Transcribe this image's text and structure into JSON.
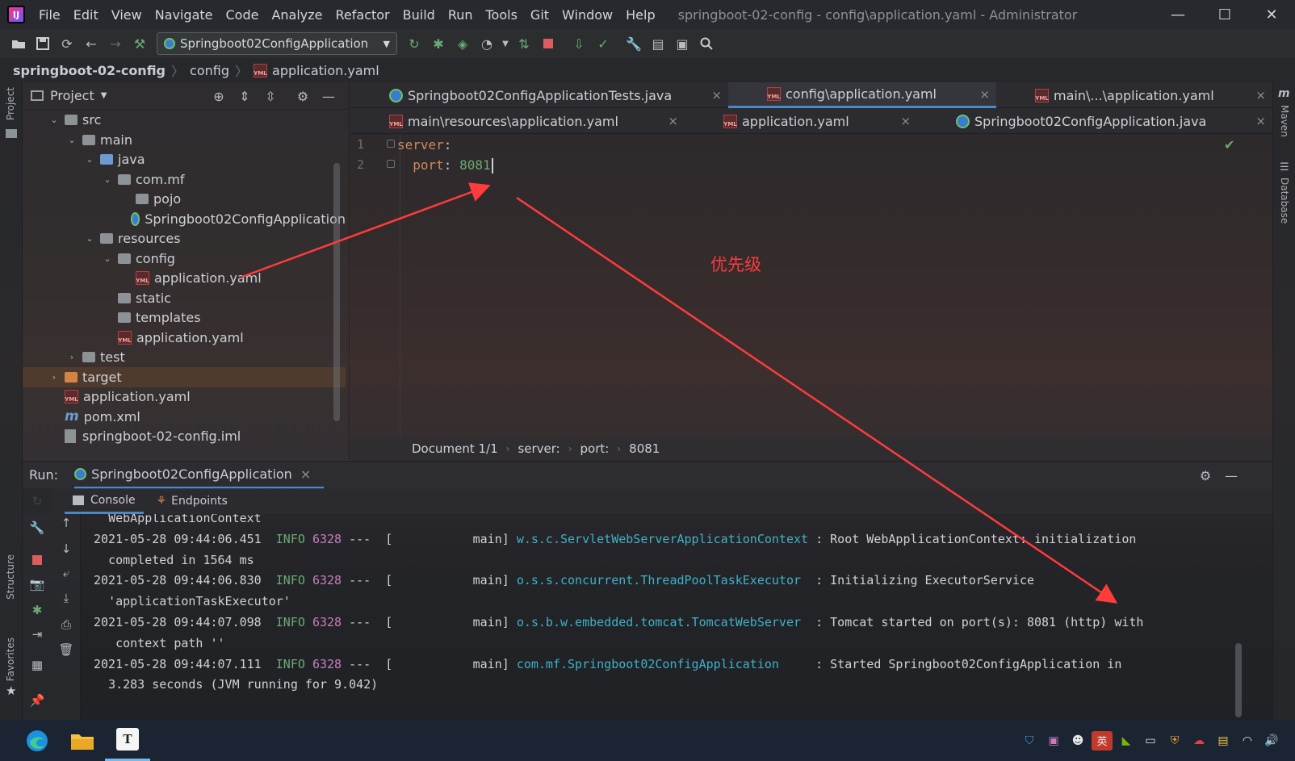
{
  "window": {
    "title": "springboot-02-config - config\\application.yaml - Administrator",
    "menu": [
      "File",
      "Edit",
      "View",
      "Navigate",
      "Code",
      "Analyze",
      "Refactor",
      "Build",
      "Run",
      "Tools",
      "Git",
      "Window",
      "Help"
    ],
    "controls": {
      "minimize": "—",
      "maximize": "☐",
      "close": "✕"
    }
  },
  "toolbar": {
    "run_config": "Springboot02ConfigApplication"
  },
  "breadcrumb": [
    "springboot-02-config",
    "config",
    "application.yaml"
  ],
  "left_stripe": {
    "project": "Project",
    "structure": "Structure",
    "favorites": "Favorites"
  },
  "right_stripe": {
    "maven": "Maven",
    "database": "Database"
  },
  "project_panel": {
    "title": "Project",
    "tree": [
      {
        "label": "src",
        "type": "folder-grey",
        "indent": 1,
        "arrow": "⌄"
      },
      {
        "label": "main",
        "type": "folder-grey",
        "indent": 2,
        "arrow": "⌄"
      },
      {
        "label": "java",
        "type": "folder-blue",
        "indent": 3,
        "arrow": "⌄"
      },
      {
        "label": "com.mf",
        "type": "folder-grey",
        "indent": 4,
        "arrow": "⌄"
      },
      {
        "label": "pojo",
        "type": "folder-grey",
        "indent": 5,
        "arrow": ""
      },
      {
        "label": "Springboot02ConfigApplication",
        "type": "spring",
        "indent": 5,
        "arrow": ""
      },
      {
        "label": "resources",
        "type": "folder-grey",
        "indent": 3,
        "arrow": "⌄"
      },
      {
        "label": "config",
        "type": "folder-grey",
        "indent": 4,
        "arrow": "⌄"
      },
      {
        "label": "application.yaml",
        "type": "yml",
        "indent": 5,
        "arrow": ""
      },
      {
        "label": "static",
        "type": "folder-grey",
        "indent": 4,
        "arrow": ""
      },
      {
        "label": "templates",
        "type": "folder-grey",
        "indent": 4,
        "arrow": ""
      },
      {
        "label": "application.yaml",
        "type": "yml",
        "indent": 4,
        "arrow": ""
      },
      {
        "label": "test",
        "type": "folder-grey",
        "indent": 2,
        "arrow": "›"
      },
      {
        "label": "target",
        "type": "folder-orange",
        "indent": 1,
        "arrow": "›"
      },
      {
        "label": "application.yaml",
        "type": "yml",
        "indent": 1,
        "arrow": ""
      },
      {
        "label": "pom.xml",
        "type": "maven",
        "indent": 1,
        "arrow": ""
      },
      {
        "label": "springboot-02-config.iml",
        "type": "iml",
        "indent": 1,
        "arrow": ""
      }
    ]
  },
  "editor_tabs": {
    "row1": [
      {
        "label": "Springboot02ConfigApplicationTests.java",
        "icon": "spring",
        "active": false
      },
      {
        "label": "config\\application.yaml",
        "icon": "yml",
        "active": true
      },
      {
        "label": "main\\...\\application.yaml",
        "icon": "yml",
        "active": false
      }
    ],
    "row2": [
      {
        "label": "main\\resources\\application.yaml",
        "icon": "yml",
        "active": false
      },
      {
        "label": "application.yaml",
        "icon": "yml",
        "active": false
      },
      {
        "label": "Springboot02ConfigApplication.java",
        "icon": "spring",
        "active": false
      }
    ],
    "close": "×"
  },
  "editor": {
    "lines": [
      {
        "num": "1",
        "key": "server",
        "sep": ":",
        "value": ""
      },
      {
        "num": "2",
        "key": "  port",
        "sep": ": ",
        "value": "8081"
      }
    ],
    "status_crumbs": [
      "Document 1/1",
      "server:",
      "port:",
      "8081"
    ],
    "check": "✔"
  },
  "annotation": {
    "text": "优先级",
    "color": "#ff3b3b"
  },
  "run_panel": {
    "label": "Run:",
    "tab": "Springboot02ConfigApplication",
    "subtabs": [
      "Console",
      "Endpoints"
    ],
    "console": [
      {
        "indent": "  ",
        "text": "WebApplicationContext"
      },
      {
        "ts": "2021-05-28 09:44:06.451",
        "level": "INFO",
        "pid": "6328",
        "thread": "---  [           main]",
        "logger": "w.s.c.ServletWebServerApplicationContext",
        "msg": " : Root WebApplicationContext: initialization"
      },
      {
        "indent": "  ",
        "text": "completed in 1564 ms"
      },
      {
        "ts": "2021-05-28 09:44:06.830",
        "level": "INFO",
        "pid": "6328",
        "thread": "---  [           main]",
        "logger": "o.s.s.concurrent.ThreadPoolTaskExecutor ",
        "msg": " : Initializing ExecutorService"
      },
      {
        "indent": "  ",
        "text": "'applicationTaskExecutor'"
      },
      {
        "ts": "2021-05-28 09:44:07.098",
        "level": "INFO",
        "pid": "6328",
        "thread": "---  [           main]",
        "logger": "o.s.b.w.embedded.tomcat.TomcatWebServer ",
        "msg": " : Tomcat started on port(s): 8081 (http) with"
      },
      {
        "indent": "   ",
        "text": "context path ''"
      },
      {
        "ts": "2021-05-28 09:44:07.111",
        "level": "INFO",
        "pid": "6328",
        "thread": "---  [           main]",
        "logger": "com.mf.Springboot02ConfigApplication    ",
        "msg": " : Started Springboot02ConfigApplication in"
      },
      {
        "indent": "  ",
        "text": "3.283 seconds (JVM running for 9.042)"
      }
    ]
  },
  "taskbar": {
    "apps": [
      "edge-icon",
      "file-explorer-icon",
      "typora-icon"
    ],
    "typora_letter": "T",
    "tray_en": "英"
  }
}
